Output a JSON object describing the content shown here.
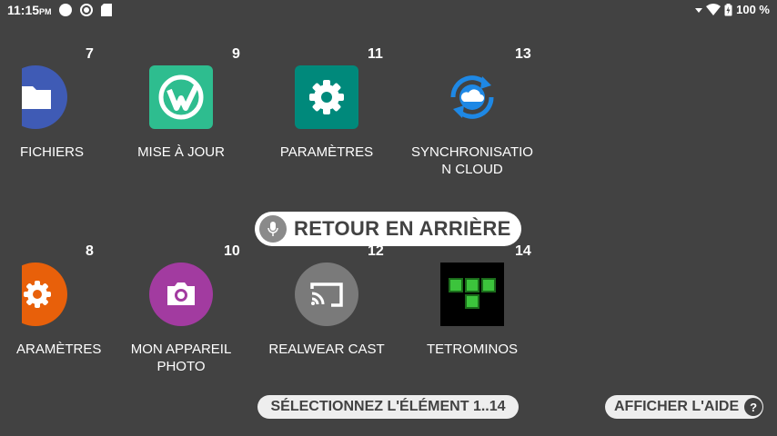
{
  "status_bar": {
    "time": "11:15",
    "ampm": "PM",
    "battery": "100 %"
  },
  "apps": [
    {
      "num": "7",
      "label": "FICHIERS",
      "icon": "folder-icon",
      "color": "#3f5bb5"
    },
    {
      "num": "9",
      "label": "MISE À JOUR",
      "icon": "update-w-icon",
      "color": "#2ebd8f"
    },
    {
      "num": "11",
      "label": "PARAMÈTRES",
      "icon": "gear-icon",
      "color": "#00897b"
    },
    {
      "num": "13",
      "label_line1": "SYNCHRONISATIO",
      "label_line2": "N CLOUD",
      "icon": "cloud-sync-icon",
      "color": "#1e88e5"
    },
    {
      "num": "8",
      "label": "ARAMÈTRES",
      "icon": "gear-icon",
      "color": "#e8600a"
    },
    {
      "num": "10",
      "label_line1": "MON APPAREIL",
      "label_line2": "PHOTO",
      "icon": "camera-icon",
      "color": "#a23ba0"
    },
    {
      "num": "12",
      "label": "REALWEAR CAST",
      "icon": "cast-icon",
      "color": "#7a7a7a"
    },
    {
      "num": "14",
      "label": "TETROMINOS",
      "icon": "tetromino-icon",
      "color": "#000000"
    }
  ],
  "voice": {
    "retour": "RETOUR EN ARRIÈRE",
    "select": "SÉLECTIONNEZ L'ÉLÉMENT 1..14",
    "help": "AFFICHER L'AIDE",
    "help_icon": "?"
  }
}
